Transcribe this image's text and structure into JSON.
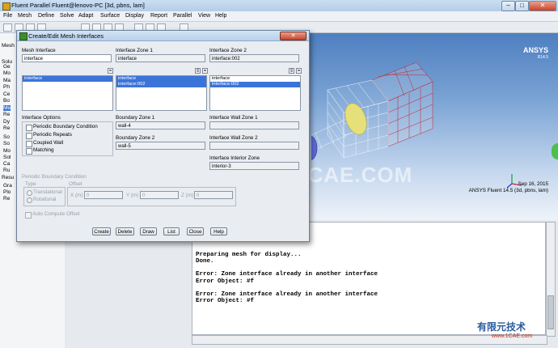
{
  "window": {
    "title": "Fluent Parallel Fluent@lenovo-PC  [3d, pbns, lam]"
  },
  "menu": [
    "File",
    "Mesh",
    "Define",
    "Solve",
    "Adapt",
    "Surface",
    "Display",
    "Report",
    "Parallel",
    "View",
    "Help"
  ],
  "left_panel": {
    "items": [
      "Mesh",
      "Ge",
      "Mo",
      "Ma",
      "Ph",
      "Ce",
      "Bo",
      "Me",
      "Re",
      "Dy",
      "Re",
      "Solu",
      "So",
      "So",
      "Mo",
      "Sol",
      "Ca",
      "Ru",
      "Resu",
      "Gra",
      "Plo",
      "Re"
    ],
    "headers": [
      "Mesh",
      "Solu",
      "Solu",
      "Resu"
    ]
  },
  "graphics": {
    "logo": "ANSYS",
    "logo_version": "R14.5",
    "date": "Sep 16, 2015",
    "product": "ANSYS Fluent 14.5 (3d, pbns, lam)",
    "watermark": "1CAE.COM",
    "corner_watermark": "有限元技术",
    "corner_url": "www.1CAE.com"
  },
  "console": {
    "text": "        fluid\n      parallel,\nDone.\n\nPreparing mesh for display...\nDone.\n\nError: Zone interface already in another interface\nError Object: #f\n\nError: Zone interface already in another interface\nError Object: #f"
  },
  "dialog": {
    "title": "Create/Edit Mesh Interfaces",
    "mesh_interface_label": "Mesh Interface",
    "mesh_interface_value": "interface",
    "mesh_interface_list": [
      "interface"
    ],
    "zone1_label": "Interface Zone 1",
    "zone1_value": "interface",
    "zone1_list": [
      "interface",
      "interface:002"
    ],
    "zone2_label": "Interface Zone 2",
    "zone2_value": "interface:002",
    "zone2_list": [
      "interface",
      "interface:002"
    ],
    "options_label": "Interface Options",
    "options": [
      "Periodic Boundary Condition",
      "Periodic Repeats",
      "Coupled Wall",
      "Matching"
    ],
    "bz1_label": "Boundary Zone 1",
    "bz1_value": "wall-4",
    "bz2_label": "Boundary Zone 2",
    "bz2_value": "wall-5",
    "iwz1_label": "Interface Wall Zone 1",
    "iwz2_label": "Interface Wall Zone 2",
    "iiz_label": "Interface Interior Zone",
    "iiz_value": "interior-3",
    "periodic_label": "Periodic Boundary Condition",
    "type_label": "Type",
    "offset_label": "Offset",
    "translational": "Translational",
    "rotational": "Rotational",
    "x_label": "X (m)",
    "y_label": "Y (m)",
    "z_label": "Z (m)",
    "x_value": "0",
    "y_value": "0",
    "z_value": "0",
    "auto_offset": "Auto Compute Offset",
    "buttons": [
      "Create",
      "Delete",
      "Draw",
      "List",
      "Close",
      "Help"
    ]
  }
}
